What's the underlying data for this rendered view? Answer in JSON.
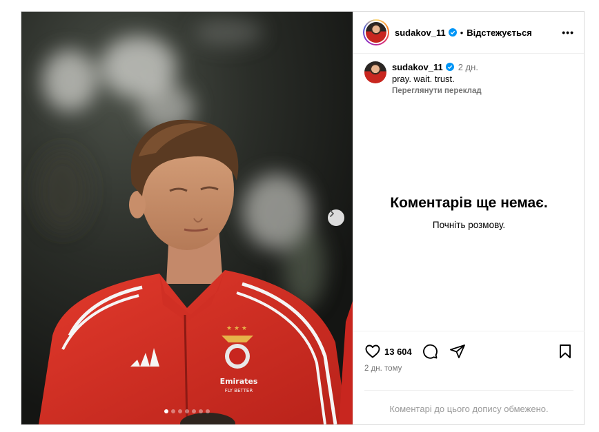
{
  "post": {
    "username": "sudakov_11",
    "follow_status": "Відстежується",
    "separator": "•",
    "more_label": "•••",
    "caption_text": "pray. wait. trust.",
    "caption_time": "2 дн.",
    "translate_label": "Переглянути переклад",
    "empty_title": "Коментарів ще немає.",
    "empty_subtitle": "Почніть розмову.",
    "likes": "13 604",
    "time_ago": "2 дн. тому",
    "comments_restricted": "Коментарі до цього допису обмежено.",
    "carousel": {
      "total": 7,
      "active_index": 0
    },
    "colors": {
      "verified": "#0095f6",
      "secondary": "#737373",
      "border": "#dbdbdb"
    },
    "icons": [
      "verified-badge-icon",
      "more-options-icon",
      "chevron-right-icon",
      "heart-icon",
      "comment-icon",
      "share-icon",
      "bookmark-icon"
    ]
  }
}
